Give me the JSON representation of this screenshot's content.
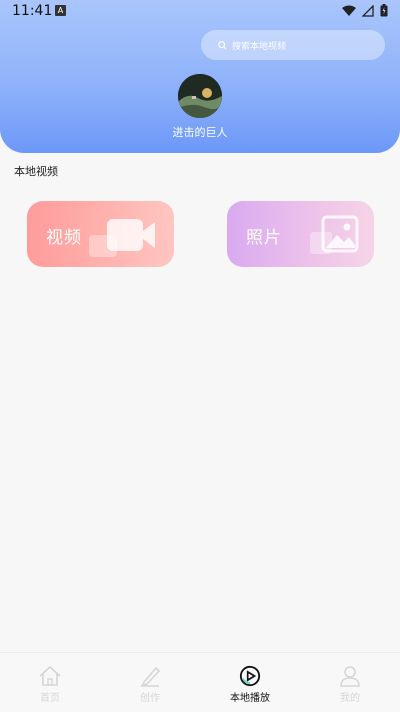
{
  "status": {
    "time": "11:41",
    "a_badge": "A"
  },
  "search": {
    "placeholder": "搜索本地视频"
  },
  "profile": {
    "name": "进击的巨人"
  },
  "section": {
    "title": "本地视频"
  },
  "cards": [
    {
      "label": "视频",
      "icon": "video-camera-icon"
    },
    {
      "label": "照片",
      "icon": "photo-icon"
    }
  ],
  "tabs": [
    {
      "label": "首页",
      "icon": "home-icon",
      "active": false
    },
    {
      "label": "创作",
      "icon": "pencil-icon",
      "active": false
    },
    {
      "label": "本地播放",
      "icon": "play-circle-icon",
      "active": true
    },
    {
      "label": "我的",
      "icon": "user-icon",
      "active": false
    }
  ],
  "colors": {
    "header_top": "#a9c5fb",
    "header_bottom": "#6c98f7",
    "video_card": "#fe9c9c",
    "photo_card": "#d9aaf0",
    "active_tab": "#111111",
    "inactive_tab": "#d6d6d6"
  }
}
